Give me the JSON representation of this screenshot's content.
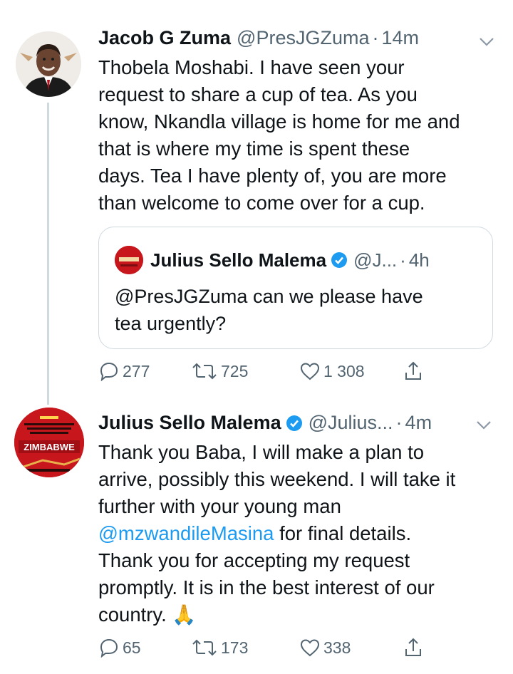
{
  "tweet1": {
    "name": "Jacob G Zuma",
    "handle": "@PresJGZuma",
    "separator": "·",
    "time": "14m",
    "lines": [
      "Thobela Moshabi. I have seen your",
      "request to share a cup of tea. As you",
      "know, Nkandla village is home for me and",
      "that is where my time is spent these",
      "days. Tea I have plenty of, you are more",
      "than welcome to come over for a cup."
    ],
    "quote": {
      "name": "Julius Sello Malema",
      "handle": "@J...",
      "separator": "·",
      "time": "4h",
      "lines": [
        "@PresJGZuma can we please have",
        "tea urgently?"
      ]
    },
    "replies": "277",
    "retweets": "725",
    "likes": "1 308"
  },
  "tweet2": {
    "name": "Julius Sello Malema",
    "handle": "@Julius...",
    "separator": "·",
    "time": "4m",
    "avatar_text": "ZIMBABWE",
    "line1": "Thank you Baba, I will make a plan to",
    "line2": "arrive, possibly this weekend. I will take it",
    "line3": "further with your young man",
    "mention": "@mzwandileMasina",
    "line4_rest": " for final details.",
    "line5": "Thank you for accepting my request",
    "line6": "promptly. It is in the best interest of our",
    "line7": "country.",
    "emoji": "🙏",
    "replies": "65",
    "retweets": "173",
    "likes": "338"
  },
  "colors": {
    "text": "#0f1419",
    "secondary": "#536471",
    "link": "#1d9bf0",
    "verified": "#1d9bf0",
    "border": "#cfd9de"
  },
  "icons": [
    "chevron-down-icon",
    "verified-badge-icon",
    "reply-icon",
    "retweet-icon",
    "like-icon",
    "share-icon",
    "pray-emoji-icon"
  ]
}
